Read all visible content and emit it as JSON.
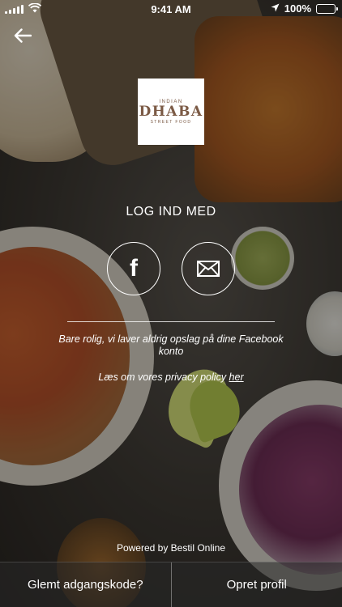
{
  "status_bar": {
    "time": "9:41 AM",
    "battery": "100%",
    "icons": [
      "signal-icon",
      "wifi-icon",
      "location-arrow-icon",
      "battery-icon"
    ]
  },
  "header": {
    "back_icon": "back-arrow-icon"
  },
  "logo": {
    "top_text": "INDIAN",
    "main_text": "DHABA",
    "bottom_text": "STREET FOOD",
    "color": "#7b5a45"
  },
  "login": {
    "title": "LOG IND MED",
    "facebook_icon": "facebook-icon",
    "email_icon": "mail-icon",
    "note": "Bare rolig, vi laver aldrig opslag på dine Facebook konto",
    "privacy_text": "Læs om vores privacy policy ",
    "privacy_link": "her"
  },
  "footer": {
    "powered_by": "Powered by Bestil Online",
    "forgot_password": "Glemt adgangskode?",
    "create_profile": "Opret profil"
  }
}
